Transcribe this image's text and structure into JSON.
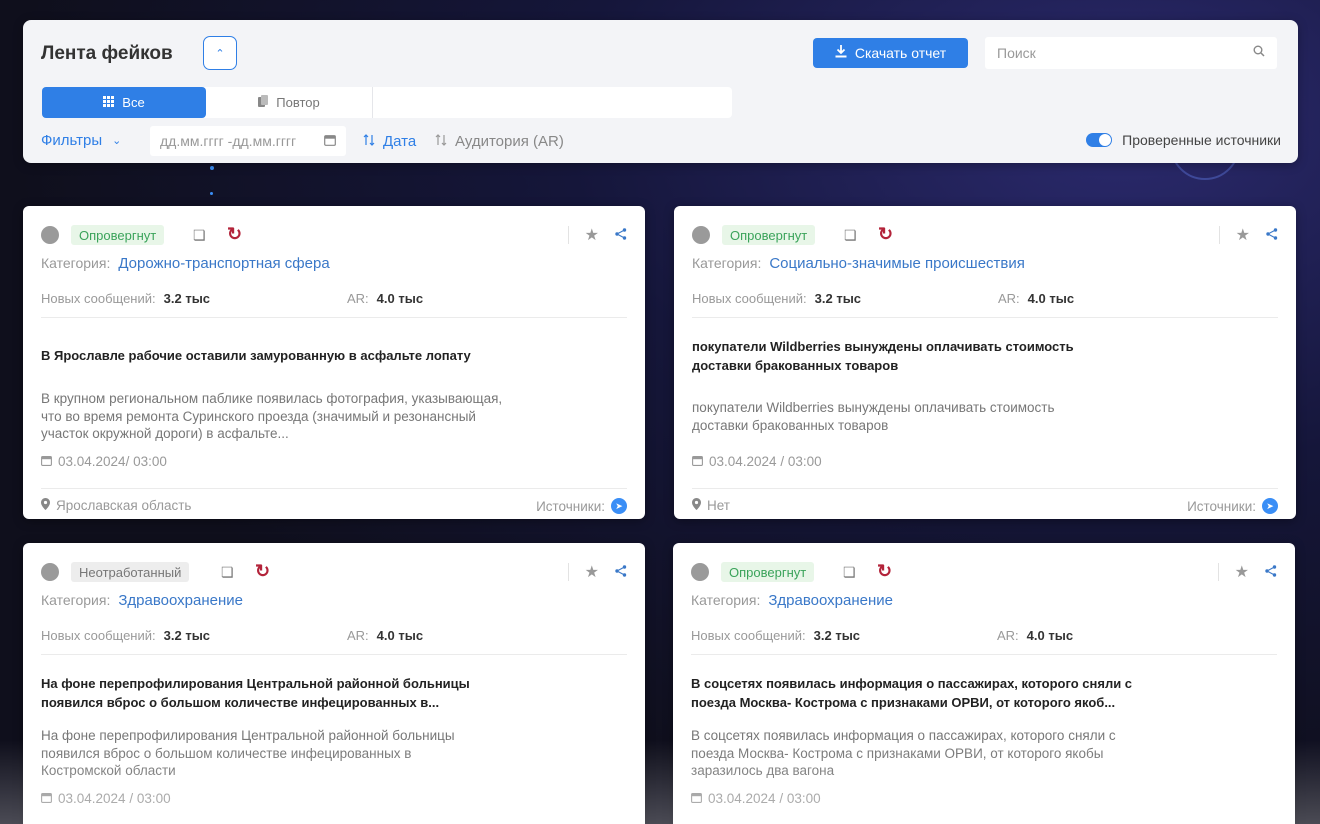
{
  "header": {
    "title": "Лента фейков",
    "download_label": "Скачать отчет",
    "search_placeholder": "Поиск",
    "tabs": [
      {
        "label": "Все",
        "icon": "grid-icon",
        "active": true
      },
      {
        "label": "Повтор",
        "icon": "copy-icon",
        "active": false
      }
    ],
    "filters_label": "Фильтры",
    "date_placeholder": "дд.мм.гггг -дд.мм.гггг",
    "sort_date_label": "Дата",
    "sort_audience_label": "Аудитория (AR)",
    "verified_label": "Проверенные источники",
    "verified_on": true
  },
  "labels": {
    "category": "Категория:",
    "new_messages": "Новых сообщений:",
    "ar": "AR:",
    "sources": "Источники:"
  },
  "cards": [
    {
      "status": "Опровергнут",
      "category": "Дорожно-транспортная сфера",
      "new_messages": "3.2 тыс",
      "ar": "4.0 тыс",
      "headline": "В Ярославле рабочие оставили замурованную в асфальте лопату",
      "description": "В крупном региональном паблике появилась фотография, указывающая, что во время ремонта Суринского проезда (значимый и резонансный участок окружной дороги) в асфальте...",
      "date": "03.04.2024/ 03:00",
      "region": "Ярославская область"
    },
    {
      "status": "Опровергнут",
      "category": "Социально-значимые происшествия",
      "new_messages": "3.2 тыс",
      "ar": "4.0 тыс",
      "headline": "покупатели Wildberries вынуждены оплачивать стоимость доставки бракованных товаров",
      "description": "покупатели Wildberries вынуждены оплачивать стоимость доставки бракованных товаров",
      "date": "03.04.2024 / 03:00",
      "region": "Нет"
    },
    {
      "status": "Неотработанный",
      "category": "Здравоохранение",
      "new_messages": "3.2 тыс",
      "ar": "4.0 тыс",
      "headline": "На фоне перепрофилирования Центральной районной больницы появился вброс о большом количестве инфецированных в...",
      "description": "На фоне перепрофилирования Центральной районной больницы появился вброс о большом количестве инфецированных в Костромской области",
      "date": "03.04.2024 / 03:00"
    },
    {
      "status": "Опровергнут",
      "category": "Здравоохранение",
      "new_messages": "3.2 тыс",
      "ar": "4.0 тыс",
      "headline": "В соцсетях появилась информация о пассажирах, которого сняли с поезда Москва- Кострома с признаками ОРВИ, от которого якоб...",
      "description": "В соцсетях появилась информация о пассажирах, которого сняли с поезда Москва- Кострома с признаками ОРВИ, от которого якобы заразилось два вагона",
      "date": "03.04.2024 / 03:00"
    }
  ],
  "colors": {
    "accent": "#2f7fe6",
    "refuted_badge": "#3aa35a",
    "refresh_icon": "#b3233a"
  }
}
